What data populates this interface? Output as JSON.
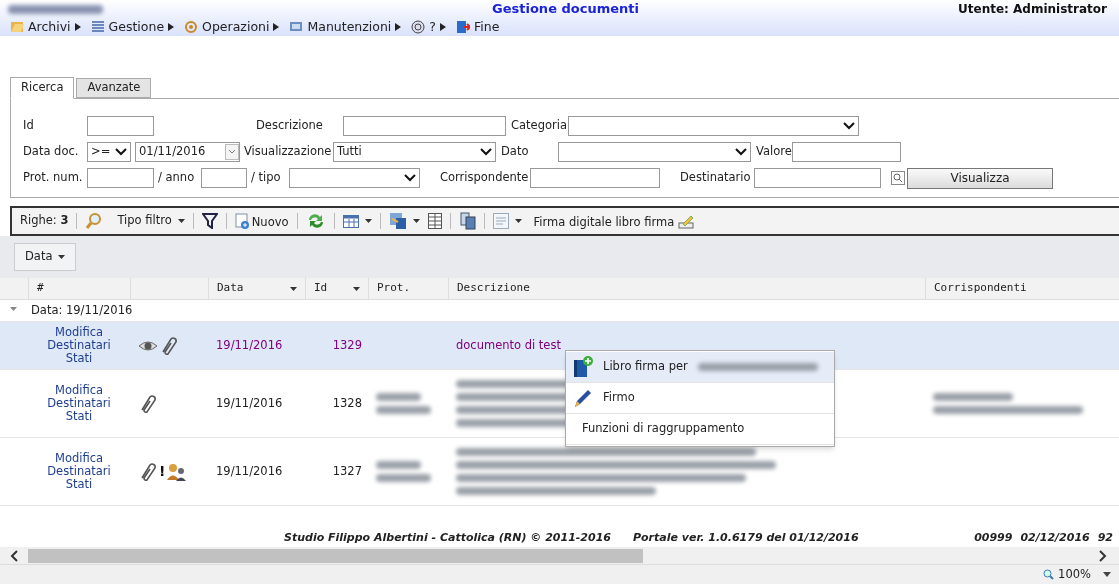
{
  "header": {
    "title": "Gestione documenti",
    "user": "Utente: Administrator"
  },
  "menu": [
    {
      "label": "Archivi",
      "submenu": true
    },
    {
      "label": "Gestione",
      "submenu": true
    },
    {
      "label": "Operazioni",
      "submenu": true
    },
    {
      "label": "Manutenzioni",
      "submenu": true
    },
    {
      "label": "?",
      "submenu": true
    },
    {
      "label": "Fine",
      "submenu": false
    }
  ],
  "tabs": [
    {
      "label": "Ricerca",
      "selected": true
    },
    {
      "label": "Avanzate",
      "selected": false
    }
  ],
  "form": {
    "id_label": "Id",
    "descrizione_label": "Descrizione",
    "categoria_label": "Categoria",
    "data_label": "Data doc.",
    "data_op": ">=",
    "data_value": "01/11/2016",
    "visualizzazione_label": "Visualizzazione",
    "visualizzazione_value": "Tutti",
    "dato_label": "Dato",
    "valore_label": "Valore",
    "prot_label": "Prot. num.",
    "anno_label": "/ anno",
    "tipo_label": "/ tipo",
    "corrispondente_label": "Corrispondente",
    "destinatario_label": "Destinatario",
    "button": "Visualizza"
  },
  "toolbar": {
    "rows": "Righe: **3**",
    "filter_type": "Tipo filtro",
    "new": "Nuovo",
    "sign": "Firma digitale libro firma"
  },
  "group_chip": "Data",
  "table": {
    "columns": [
      {
        "label": "#",
        "sortable": false
      },
      {
        "sortable": false
      },
      {
        "label": "Data",
        "sortable": true
      },
      {
        "label": "Id",
        "sortable": true
      },
      {
        "label": "Prot.",
        "sortable": false
      },
      {
        "label": "Descrizione",
        "sortable": false
      },
      {
        "label": "Corrispondenti",
        "sortable": false
      }
    ],
    "group": {
      "label": "Data: 19/11/2016",
      "expanded": true
    },
    "rows": [
      {
        "links": [
          "Modifica",
          "Destinatari",
          "Stati"
        ],
        "viewed": true,
        "attachment": true,
        "assigned": false,
        "data": "19/11/2016",
        "id": "1329",
        "prot_blurred": false,
        "descrizione": "documento di test",
        "corrispondenti_blurred": false,
        "selected": true
      },
      {
        "links": [
          "Modifica",
          "Destinatari",
          "Stati"
        ],
        "viewed": false,
        "attachment": true,
        "assigned": false,
        "data": "19/11/2016",
        "id": "1328",
        "prot_blurred": true,
        "corrispondenti_blurred": true,
        "selected": false
      },
      {
        "links": [
          "Modifica",
          "Destinatari",
          "Stati"
        ],
        "viewed": false,
        "attachment": true,
        "flag": "!",
        "assigned": true,
        "data": "19/11/2016",
        "id": "1327",
        "prot_blurred": true,
        "corrispondenti_blurred": false,
        "selected": false
      }
    ]
  },
  "context_menu": [
    {
      "label": "Libro firma per",
      "kind": "book",
      "selected": true
    },
    {
      "label": "Firmo",
      "kind": "pen",
      "selected": false
    },
    {
      "label": "Funzioni di raggruppamento",
      "kind": "plain",
      "selected": false
    }
  ],
  "footer": {
    "credits": "Studio Filippo Albertini - Cattolica (RN) © 2011-2016",
    "version": "Portale ver. 1.0.6179 del 01/12/2016",
    "code": "00999",
    "date": "02/12/2016",
    "number": "92"
  },
  "status": {
    "zoom": "100%"
  }
}
